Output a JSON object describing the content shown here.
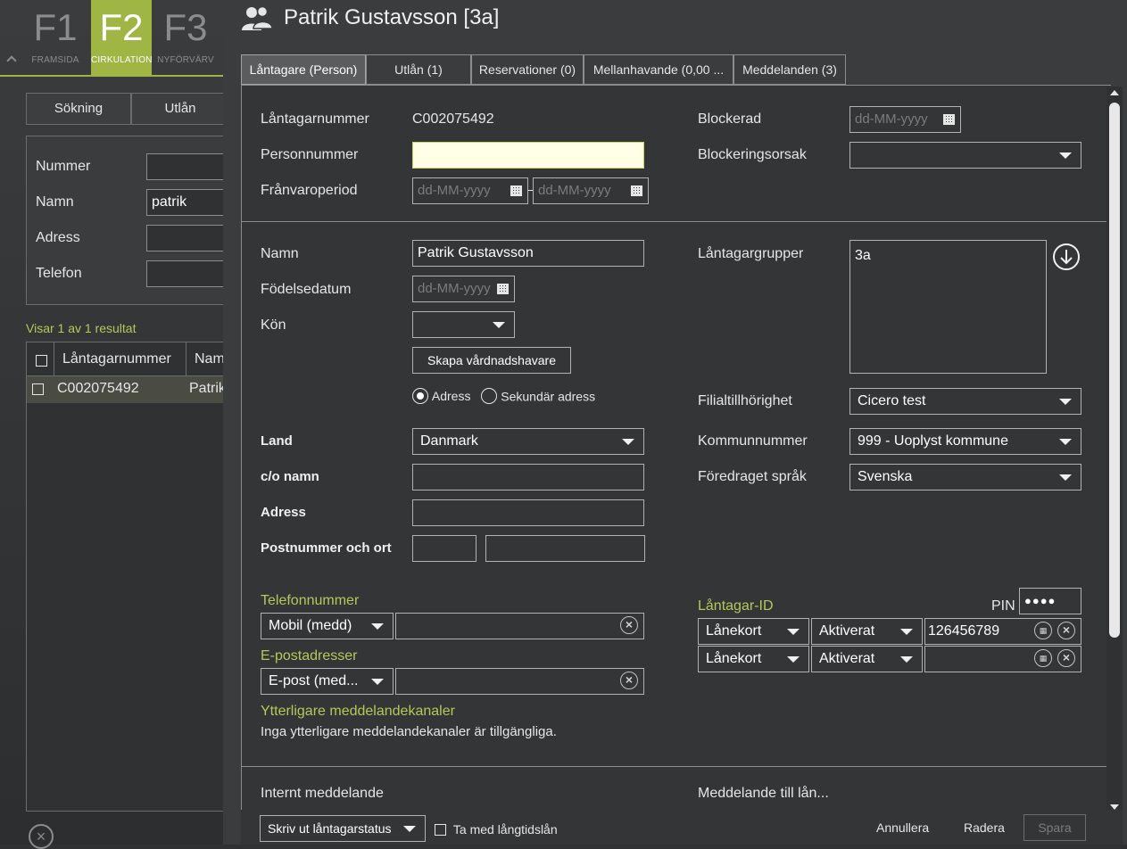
{
  "background": {
    "fkeys": [
      {
        "key": "F1",
        "label": "FRAMSIDA"
      },
      {
        "key": "F2",
        "label": "CIRKULATION"
      },
      {
        "key": "F3",
        "label": "NYFÖRVÄRV"
      }
    ],
    "tabs": [
      "Sökning",
      "Utlån"
    ],
    "search": {
      "nummer_label": "Nummer",
      "namn_label": "Namn",
      "namn_value": "patrik",
      "adress_label": "Adress",
      "telefon_label": "Telefon"
    },
    "result_text": "Visar 1 av 1 resultat",
    "table": {
      "col1": "Låntagarnummer",
      "col2": "Nam",
      "row1_col1": "C002075492",
      "row1_col2": "Patrik"
    }
  },
  "dialog": {
    "title": "Patrik Gustavsson [3a]",
    "tabs": [
      "Låntagare (Person)",
      "Utlån (1)",
      "Reservationer (0)",
      "Mellanhavande (0,00 ...",
      "Meddelanden (3)"
    ],
    "fields": {
      "lantagarnummer_label": "Låntagarnummer",
      "lantagarnummer_value": "C002075492",
      "personnummer_label": "Personnummer",
      "franvaro_label": "Frånvaroperiod",
      "date_placeholder": "dd-MM-yyyy",
      "date_placeholder_short": "dd-MM-yyyy",
      "blockerad_label": "Blockerad",
      "blockeringsorsak_label": "Blockeringsorsak",
      "namn_label": "Namn",
      "namn_value": "Patrik Gustavsson",
      "fodelsedatum_label": "Födelsedatum",
      "kon_label": "Kön",
      "skapa_button": "Skapa vårdnadshavare",
      "adress_radio": "Adress",
      "sekundar_radio": "Sekundär adress",
      "lantagargrupper_label": "Låntagargrupper",
      "lantagargrupper_value": "3a",
      "filial_label": "Filialtillhörighet",
      "filial_value": "Cicero test",
      "land_label": "Land",
      "land_value": "Danmark",
      "co_label": "c/o namn",
      "adress_label": "Adress",
      "postnr_label": "Postnummer och ort",
      "kommun_label": "Kommunnummer",
      "kommun_value": "999 - Uoplyst kommune",
      "sprak_label": "Föredraget språk",
      "sprak_value": "Svenska",
      "telefon_section": "Telefonnummer",
      "telefon_type": "Mobil (medd)",
      "epost_section": "E-postadresser",
      "epost_type": "E-post (med...",
      "ytterligare_section": "Ytterligare meddelandekanaler",
      "ytterligare_text": "Inga ytterligare meddelandekanaler är tillgängliga.",
      "lantagarid_section": "Låntagar-ID",
      "pin_label": "PIN",
      "pin_value": "●●●●",
      "id_type": "Lånekort",
      "id_status": "Aktiverat",
      "id_value": "126456789",
      "internt_label": "Internt meddelande",
      "meddelande_label": "Meddelande till lån..."
    },
    "footer": {
      "print_select": "Skriv ut låntagarstatus",
      "checkbox_label": "Ta med långtidslån",
      "annullera": "Annullera",
      "radera": "Radera",
      "spara": "Spara"
    }
  }
}
